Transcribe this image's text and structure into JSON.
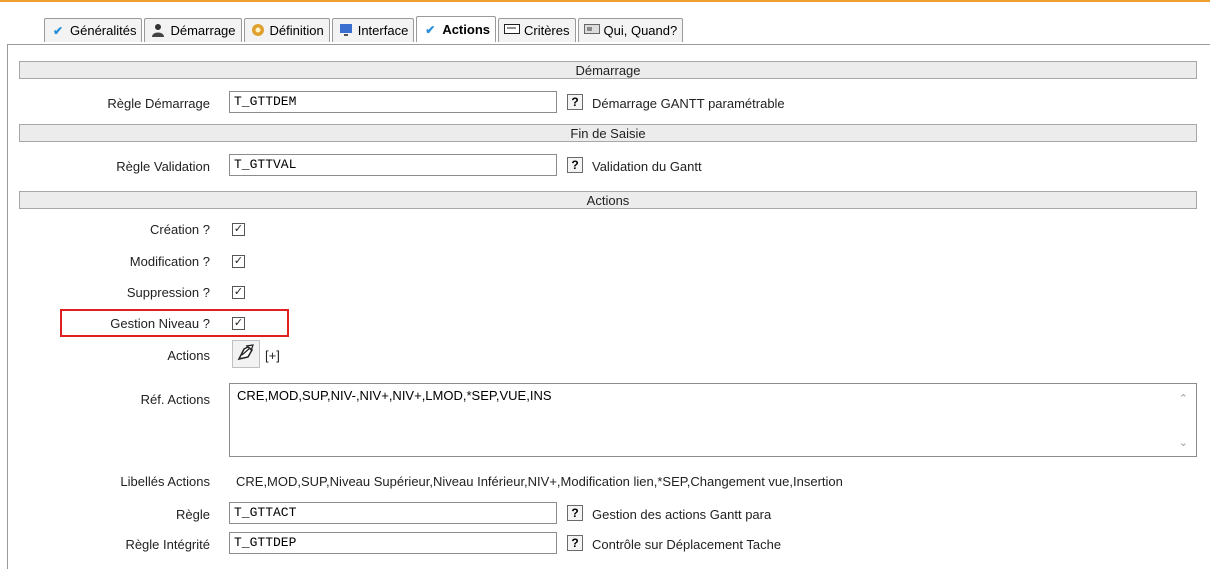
{
  "tabs": [
    {
      "label": "Généralités",
      "icon": "check-icon",
      "active": false
    },
    {
      "label": "Démarrage",
      "icon": "user-icon",
      "active": false
    },
    {
      "label": "Définition",
      "icon": "gear-icon",
      "active": false
    },
    {
      "label": "Interface",
      "icon": "monitor-icon",
      "active": false
    },
    {
      "label": "Actions",
      "icon": "check-icon",
      "active": true
    },
    {
      "label": "Critères",
      "icon": "form-icon",
      "active": false
    },
    {
      "label": "Qui, Quand?",
      "icon": "calendar-icon",
      "active": false
    }
  ],
  "sections": {
    "demarrage": "Démarrage",
    "fin_saisie": "Fin de Saisie",
    "actions": "Actions"
  },
  "regle_demarrage": {
    "label": "Règle Démarrage",
    "value": "T_GTTDEM",
    "help": "?",
    "desc": "Démarrage GANTT paramétrable"
  },
  "regle_validation": {
    "label": "Règle Validation",
    "value": "T_GTTVAL",
    "help": "?",
    "desc": "Validation du Gantt"
  },
  "checkboxes": {
    "creation": {
      "label": "Création ?",
      "checked": true
    },
    "modification": {
      "label": "Modification ?",
      "checked": true
    },
    "suppression": {
      "label": "Suppression ?",
      "checked": true
    },
    "gestion_niveau": {
      "label": "Gestion Niveau ?",
      "checked": true
    }
  },
  "actions": {
    "label": "Actions",
    "expand": "[+]"
  },
  "ref_actions": {
    "label": "Réf. Actions",
    "value": "CRE,MOD,SUP,NIV-,NIV+,NIV+,LMOD,*SEP,VUE,INS"
  },
  "libelles_actions": {
    "label": "Libellés Actions",
    "value": "CRE,MOD,SUP,Niveau Supérieur,Niveau Inférieur,NIV+,Modification lien,*SEP,Changement vue,Insertion"
  },
  "regle": {
    "label": "Règle",
    "value": "T_GTTACT",
    "help": "?",
    "desc": "Gestion des actions Gantt para"
  },
  "regle_integrite": {
    "label": "Règle Intégrité",
    "value": "T_GTTDEP",
    "help": "?",
    "desc": "Contrôle sur Déplacement Tache"
  },
  "colors": {
    "accent": "#f0a030",
    "highlight": "#e02020",
    "tab_check": "#2a8fd8"
  }
}
